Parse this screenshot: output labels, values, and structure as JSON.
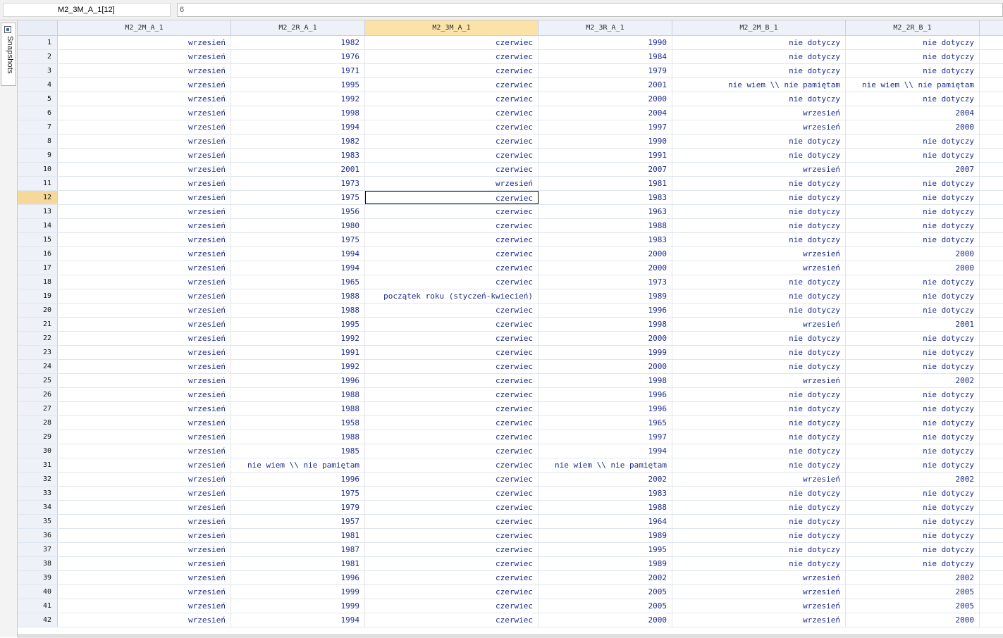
{
  "cell_reference": "M2_3M_A_1[12]",
  "cell_value": "6",
  "sidebar_tab": "Snapshots",
  "selected_row": 12,
  "selected_column_index": 2,
  "columns": [
    "M2_2M_A_1",
    "M2_2R_A_1",
    "M2_3M_A_1",
    "M2_3R_A_1",
    "M2_2M_B_1",
    "M2_2R_B_1"
  ],
  "rows": [
    [
      "1",
      "wrzesień",
      "1982",
      "czerwiec",
      "1990",
      "nie dotyczy",
      "nie dotyczy"
    ],
    [
      "2",
      "wrzesień",
      "1976",
      "czerwiec",
      "1984",
      "nie dotyczy",
      "nie dotyczy"
    ],
    [
      "3",
      "wrzesień",
      "1971",
      "czerwiec",
      "1979",
      "nie dotyczy",
      "nie dotyczy"
    ],
    [
      "4",
      "wrzesień",
      "1995",
      "czerwiec",
      "2001",
      "nie wiem \\\\ nie pamiętam",
      "nie wiem \\\\ nie pamiętam"
    ],
    [
      "5",
      "wrzesień",
      "1992",
      "czerwiec",
      "2000",
      "nie dotyczy",
      "nie dotyczy"
    ],
    [
      "6",
      "wrzesień",
      "1998",
      "czerwiec",
      "2004",
      "wrzesień",
      "2004"
    ],
    [
      "7",
      "wrzesień",
      "1994",
      "czerwiec",
      "1997",
      "wrzesień",
      "2000"
    ],
    [
      "8",
      "wrzesień",
      "1982",
      "czerwiec",
      "1990",
      "nie dotyczy",
      "nie dotyczy"
    ],
    [
      "9",
      "wrzesień",
      "1983",
      "czerwiec",
      "1991",
      "nie dotyczy",
      "nie dotyczy"
    ],
    [
      "10",
      "wrzesień",
      "2001",
      "czerwiec",
      "2007",
      "wrzesień",
      "2007"
    ],
    [
      "11",
      "wrzesień",
      "1973",
      "wrzesień",
      "1981",
      "nie dotyczy",
      "nie dotyczy"
    ],
    [
      "12",
      "wrzesień",
      "1975",
      "czerwiec",
      "1983",
      "nie dotyczy",
      "nie dotyczy"
    ],
    [
      "13",
      "wrzesień",
      "1956",
      "czerwiec",
      "1963",
      "nie dotyczy",
      "nie dotyczy"
    ],
    [
      "14",
      "wrzesień",
      "1980",
      "czerwiec",
      "1988",
      "nie dotyczy",
      "nie dotyczy"
    ],
    [
      "15",
      "wrzesień",
      "1975",
      "czerwiec",
      "1983",
      "nie dotyczy",
      "nie dotyczy"
    ],
    [
      "16",
      "wrzesień",
      "1994",
      "czerwiec",
      "2000",
      "wrzesień",
      "2000"
    ],
    [
      "17",
      "wrzesień",
      "1994",
      "czerwiec",
      "2000",
      "wrzesień",
      "2000"
    ],
    [
      "18",
      "wrzesień",
      "1965",
      "czerwiec",
      "1973",
      "nie dotyczy",
      "nie dotyczy"
    ],
    [
      "19",
      "wrzesień",
      "1988",
      "początek roku (styczeń-kwiecień)",
      "1989",
      "nie dotyczy",
      "nie dotyczy"
    ],
    [
      "20",
      "wrzesień",
      "1988",
      "czerwiec",
      "1996",
      "nie dotyczy",
      "nie dotyczy"
    ],
    [
      "21",
      "wrzesień",
      "1995",
      "czerwiec",
      "1998",
      "wrzesień",
      "2001"
    ],
    [
      "22",
      "wrzesień",
      "1992",
      "czerwiec",
      "2000",
      "nie dotyczy",
      "nie dotyczy"
    ],
    [
      "23",
      "wrzesień",
      "1991",
      "czerwiec",
      "1999",
      "nie dotyczy",
      "nie dotyczy"
    ],
    [
      "24",
      "wrzesień",
      "1992",
      "czerwiec",
      "2000",
      "nie dotyczy",
      "nie dotyczy"
    ],
    [
      "25",
      "wrzesień",
      "1996",
      "czerwiec",
      "1998",
      "wrzesień",
      "2002"
    ],
    [
      "26",
      "wrzesień",
      "1988",
      "czerwiec",
      "1996",
      "nie dotyczy",
      "nie dotyczy"
    ],
    [
      "27",
      "wrzesień",
      "1988",
      "czerwiec",
      "1996",
      "nie dotyczy",
      "nie dotyczy"
    ],
    [
      "28",
      "wrzesień",
      "1958",
      "czerwiec",
      "1965",
      "nie dotyczy",
      "nie dotyczy"
    ],
    [
      "29",
      "wrzesień",
      "1988",
      "czerwiec",
      "1997",
      "nie dotyczy",
      "nie dotyczy"
    ],
    [
      "30",
      "wrzesień",
      "1985",
      "czerwiec",
      "1994",
      "nie dotyczy",
      "nie dotyczy"
    ],
    [
      "31",
      "wrzesień",
      "nie wiem \\\\ nie pamiętam",
      "czerwiec",
      "nie wiem \\\\ nie pamiętam",
      "nie dotyczy",
      "nie dotyczy"
    ],
    [
      "32",
      "wrzesień",
      "1996",
      "czerwiec",
      "2002",
      "wrzesień",
      "2002"
    ],
    [
      "33",
      "wrzesień",
      "1975",
      "czerwiec",
      "1983",
      "nie dotyczy",
      "nie dotyczy"
    ],
    [
      "34",
      "wrzesień",
      "1979",
      "czerwiec",
      "1988",
      "nie dotyczy",
      "nie dotyczy"
    ],
    [
      "35",
      "wrzesień",
      "1957",
      "czerwiec",
      "1964",
      "nie dotyczy",
      "nie dotyczy"
    ],
    [
      "36",
      "wrzesień",
      "1981",
      "czerwiec",
      "1989",
      "nie dotyczy",
      "nie dotyczy"
    ],
    [
      "37",
      "wrzesień",
      "1987",
      "czerwiec",
      "1995",
      "nie dotyczy",
      "nie dotyczy"
    ],
    [
      "38",
      "wrzesień",
      "1981",
      "czerwiec",
      "1989",
      "nie dotyczy",
      "nie dotyczy"
    ],
    [
      "39",
      "wrzesień",
      "1996",
      "czerwiec",
      "2002",
      "wrzesień",
      "2002"
    ],
    [
      "40",
      "wrzesień",
      "1999",
      "czerwiec",
      "2005",
      "wrzesień",
      "2005"
    ],
    [
      "41",
      "wrzesień",
      "1999",
      "czerwiec",
      "2005",
      "wrzesień",
      "2005"
    ],
    [
      "42",
      "wrzesień",
      "1994",
      "czerwiec",
      "2000",
      "wrzesień",
      "2000"
    ]
  ]
}
